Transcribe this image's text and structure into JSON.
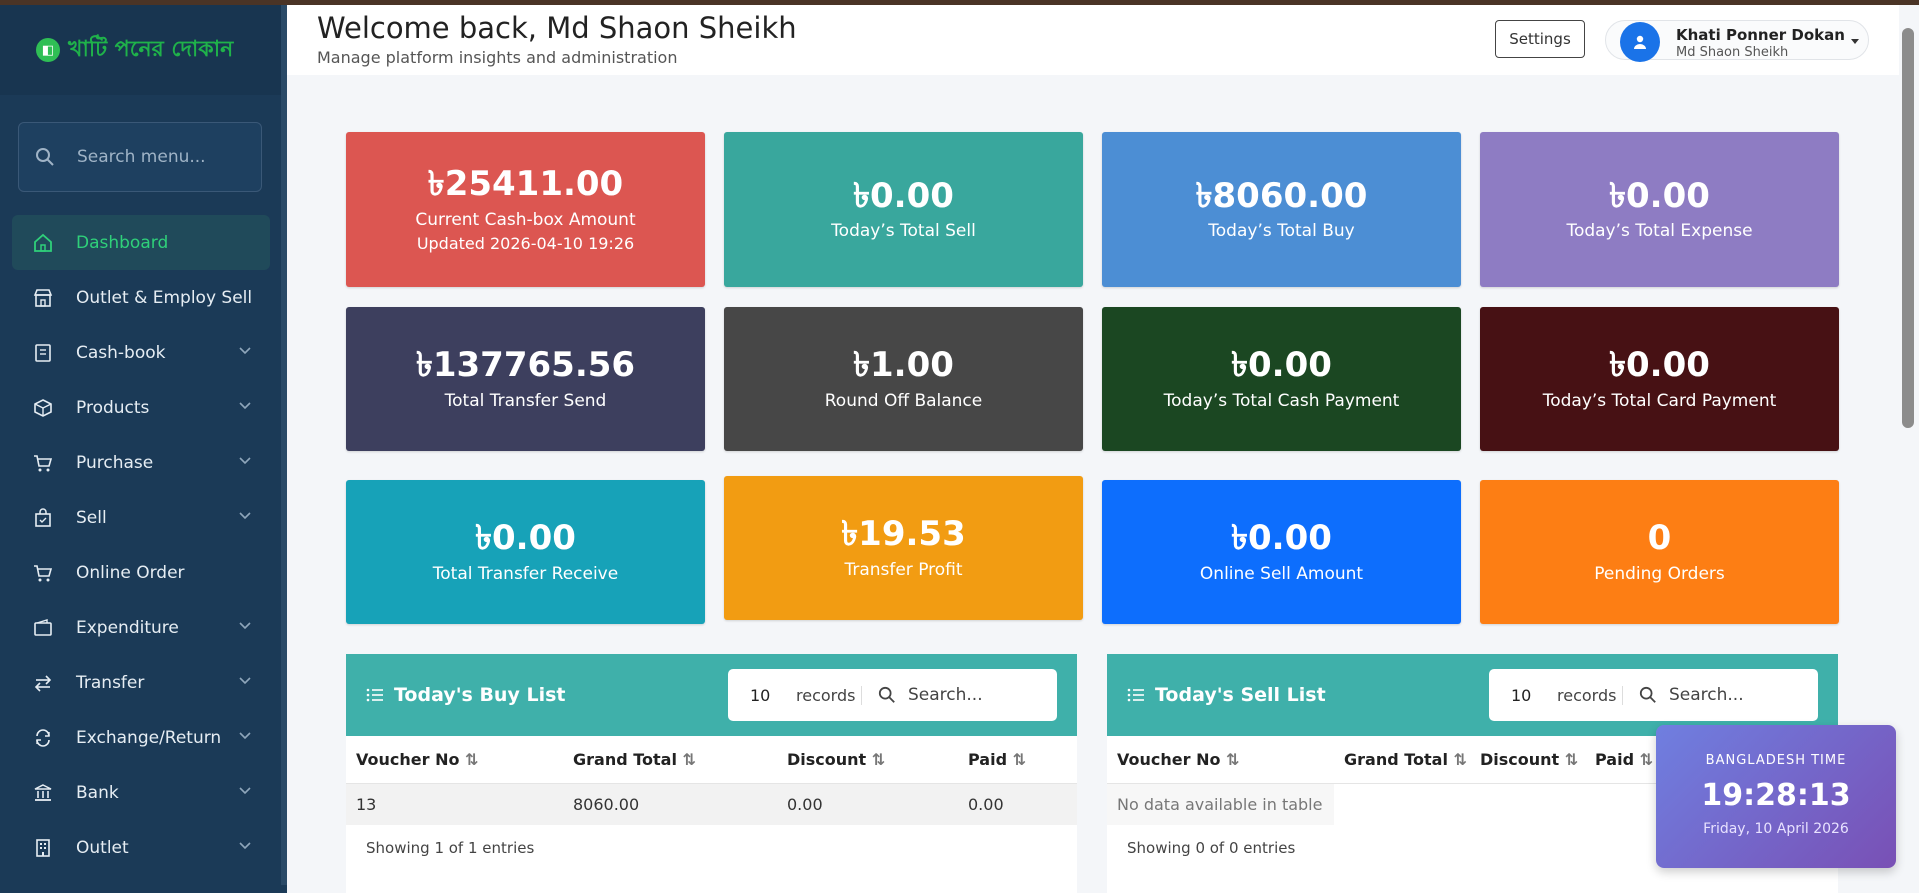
{
  "brand": {
    "name": "খাটি পনের দোকান"
  },
  "sidebar": {
    "search_placeholder": "Search menu...",
    "items": [
      {
        "label": "Dashboard",
        "icon": "home-icon",
        "active": true
      },
      {
        "label": "Outlet & Employ Sell",
        "icon": "store-icon"
      },
      {
        "label": "Cash-book",
        "icon": "book-icon",
        "expandable": true
      },
      {
        "label": "Products",
        "icon": "box-icon",
        "expandable": true
      },
      {
        "label": "Purchase",
        "icon": "cart-icon",
        "expandable": true
      },
      {
        "label": "Sell",
        "icon": "bag-icon",
        "expandable": true
      },
      {
        "label": "Online Order",
        "icon": "cart-icon"
      },
      {
        "label": "Expenditure",
        "icon": "wallet-icon",
        "expandable": true
      },
      {
        "label": "Transfer",
        "icon": "transfer-icon",
        "expandable": true
      },
      {
        "label": "Exchange/Return",
        "icon": "refresh-icon",
        "expandable": true
      },
      {
        "label": "Bank",
        "icon": "bank-icon",
        "expandable": true
      },
      {
        "label": "Outlet",
        "icon": "building-icon",
        "expandable": true
      }
    ]
  },
  "header": {
    "title": "Welcome back, Md Shaon Sheikh",
    "subtitle": "Manage platform insights and administration",
    "settings_label": "Settings",
    "profile_name": "Khati Ponner Dokan",
    "profile_user": "Md Shaon Sheikh"
  },
  "cards": [
    {
      "value": "৳25411.00",
      "label": "Current Cash-box Amount",
      "sub": "Updated 2026-04-10 19:26",
      "color": "#dc5651"
    },
    {
      "value": "৳0.00",
      "label": "Today’s Total Sell",
      "color": "#39a79d"
    },
    {
      "value": "৳8060.00",
      "label": "Today’s Total Buy",
      "color": "#4c8ed4"
    },
    {
      "value": "৳0.00",
      "label": "Today’s Total Expense",
      "color": "#8e7cc3"
    },
    {
      "value": "৳137765.56",
      "label": "Total Transfer Send",
      "color": "#3d3f5e"
    },
    {
      "value": "৳1.00",
      "label": "Round Off Balance",
      "color": "#474747"
    },
    {
      "value": "৳0.00",
      "label": "Today’s Total Cash Payment",
      "color": "#1b4722"
    },
    {
      "value": "৳0.00",
      "label": "Today’s Total Card Payment",
      "color": "#471114"
    },
    {
      "value": "৳0.00",
      "label": "Total Transfer Receive",
      "color": "#17a2b8"
    },
    {
      "value": "৳19.53",
      "label": "Transfer Profit",
      "color": "#f29c12"
    },
    {
      "value": "৳0.00",
      "label": "Online Sell Amount",
      "color": "#0d6efd"
    },
    {
      "value": "0",
      "label": "Pending Orders",
      "color": "#fd7e14"
    }
  ],
  "buy_list": {
    "title": "Today's Buy List",
    "records_count": "10",
    "records_label": "records",
    "search_placeholder": "Search...",
    "columns": [
      "Voucher No",
      "Grand Total",
      "Discount",
      "Paid"
    ],
    "rows": [
      [
        "13",
        "8060.00",
        "0.00",
        "0.00"
      ]
    ],
    "footer": "Showing 1 of 1 entries"
  },
  "sell_list": {
    "title": "Today's Sell List",
    "records_count": "10",
    "records_label": "records",
    "search_placeholder": "Search...",
    "columns": [
      "Voucher No",
      "Grand Total",
      "Discount",
      "Paid"
    ],
    "empty_text": "No data available in table",
    "footer": "Showing 0 of 0 entries"
  },
  "clock": {
    "label": "BANGLADESH TIME",
    "time": "19:28:13",
    "date": "Friday, 10 April 2026"
  }
}
